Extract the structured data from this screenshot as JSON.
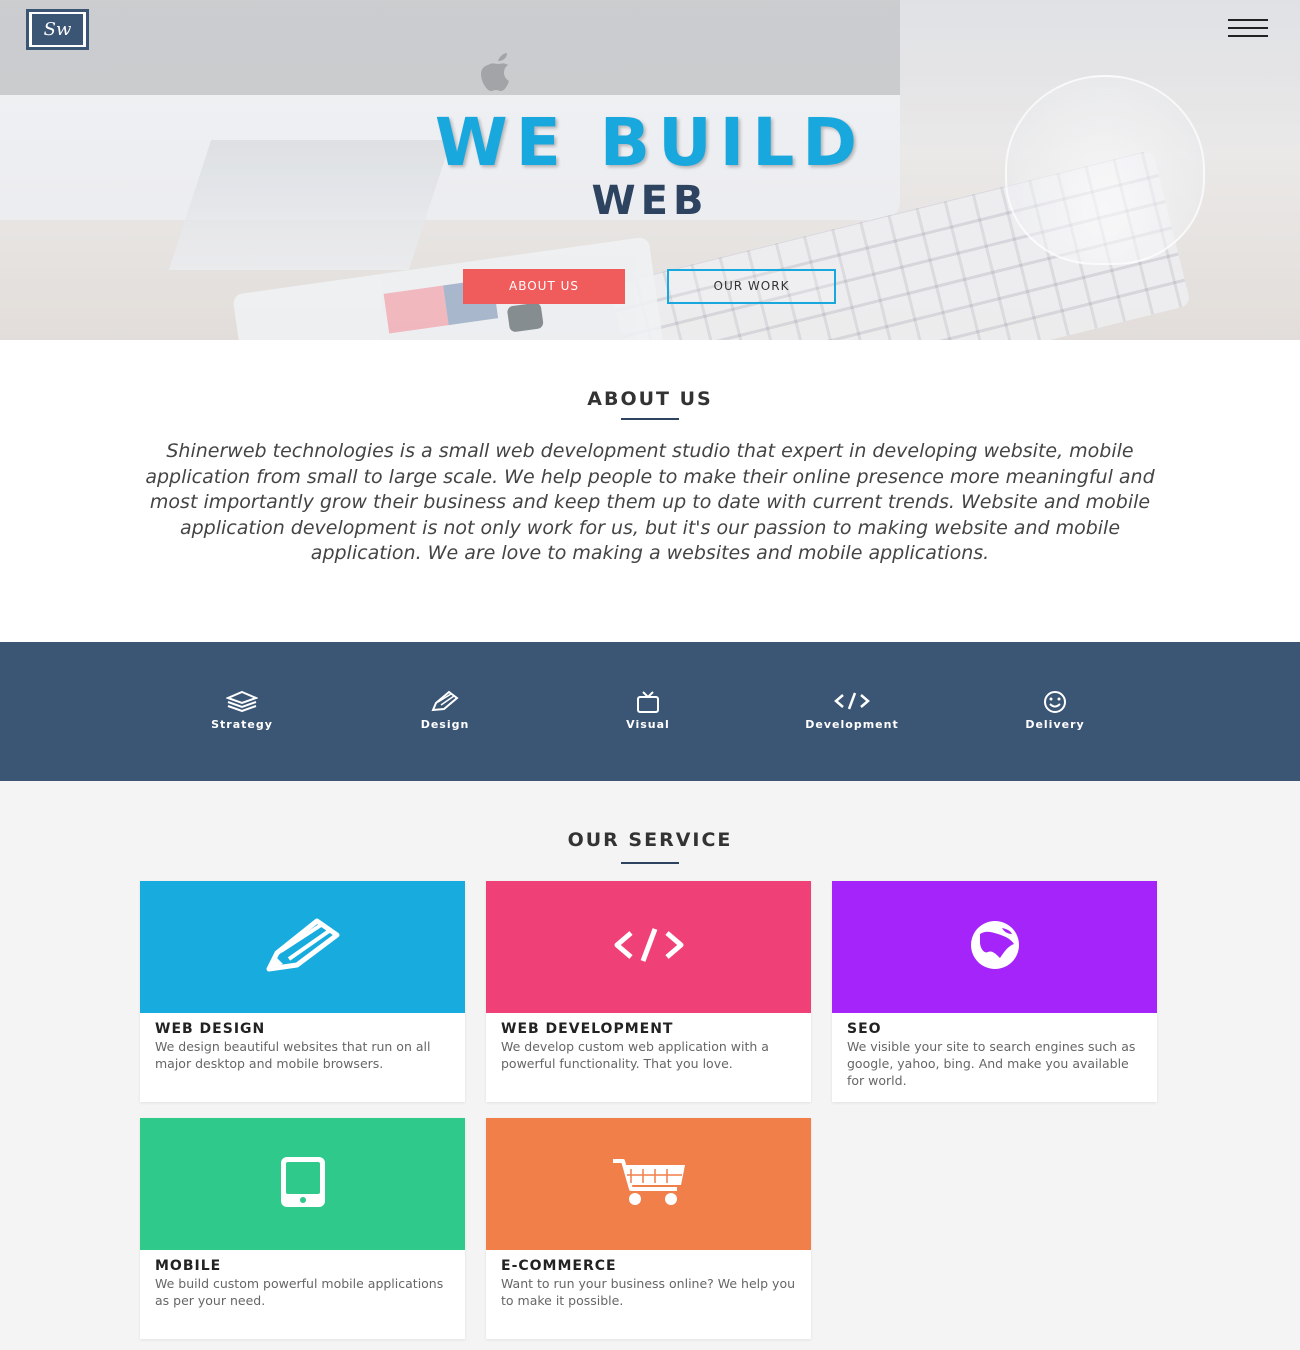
{
  "nav": {
    "logo_text": "Sw",
    "menu_icon": "hamburger-menu-icon"
  },
  "hero": {
    "title": "WE BUILD",
    "subtitle": "WEB",
    "btn_about": "ABOUT US",
    "btn_work": "OUR WORK"
  },
  "about": {
    "heading": "ABOUT US",
    "body": "Shinerweb technologies is a small web development studio that expert in developing website, mobile application from small to large scale. We help people to make their online presence more meaningful and most importantly grow their business and keep them up to date with current trends. Website and mobile application development is not only work for us, but it's our passion to making website and mobile application. We are love to making a websites and mobile applications."
  },
  "process": {
    "items": [
      {
        "label": "Strategy",
        "icon": "layers-icon"
      },
      {
        "label": "Design",
        "icon": "pencil-icon"
      },
      {
        "label": "Visual",
        "icon": "tv-icon"
      },
      {
        "label": "Development",
        "icon": "code-icon"
      },
      {
        "label": "Delivery",
        "icon": "smiley-icon"
      }
    ]
  },
  "service": {
    "heading": "OUR SERVICE",
    "cards": [
      {
        "title": "WEB DESIGN",
        "text": "We design beautiful websites that run on all major desktop and mobile browsers.",
        "color": "#18abdd",
        "icon": "pencil-icon"
      },
      {
        "title": "WEB DEVELOPMENT",
        "text": "We develop custom web application with a powerful functionality. That you love.",
        "color": "#ef4177",
        "icon": "code-icon"
      },
      {
        "title": "SEO",
        "text": "We visible your site to search engines such as google, yahoo, bing. And make you available for world.",
        "color": "#a424fa",
        "icon": "globe-icon"
      },
      {
        "title": "MOBILE",
        "text": "We build custom powerful mobile applications as per your need.",
        "color": "#2ec98b",
        "icon": "mobile-icon"
      },
      {
        "title": "E-COMMERCE",
        "text": "Want to run your business online? We help you to make it possible.",
        "color": "#f17f4a",
        "icon": "cart-icon"
      }
    ]
  }
}
